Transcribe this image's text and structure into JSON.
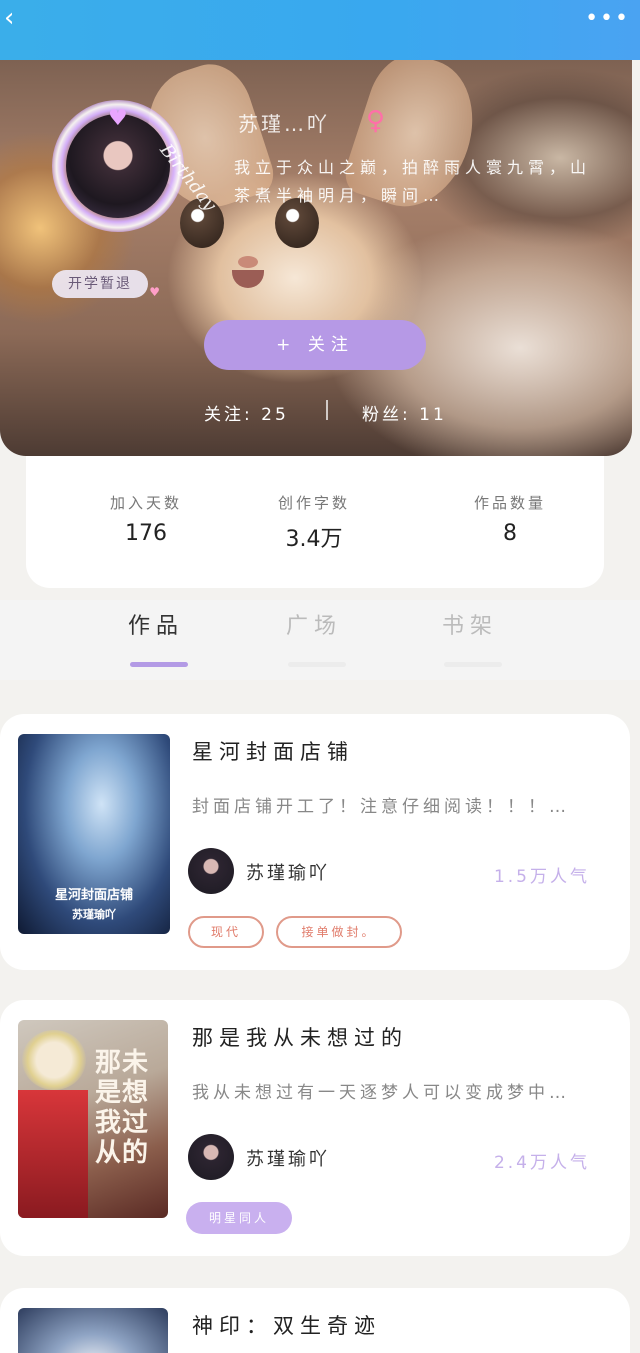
{
  "topbar": {
    "back_icon": "chevron-left-icon",
    "more_icon": "more-dots-icon",
    "back_glyph": "‹",
    "more_glyph": "•••",
    "color": "#3aaeea"
  },
  "profile": {
    "decoration_text": "Birthday",
    "status_tag": "开学暂退",
    "nickname": "苏瑾…吖",
    "gender_symbol": "♀",
    "bio": "我立于众山之巅，拍醉雨人寰九霄，山茶煮半袖明月，瞬间…",
    "follow_button": "+ 关注",
    "following": "关注: 25",
    "fans": "粉丝: 11"
  },
  "stats": [
    {
      "label": "加入天数",
      "value": "176"
    },
    {
      "label": "创作字数",
      "value": "3.4万"
    },
    {
      "label": "作品数量",
      "value": "8"
    }
  ],
  "tabs": [
    {
      "label": "作品",
      "active": true
    },
    {
      "label": "广场",
      "active": false
    },
    {
      "label": "书架",
      "active": false
    }
  ],
  "books": [
    {
      "title": "星河封面店铺",
      "desc": "封面店铺开工了！注意仔细阅读！！！…",
      "author": "苏瑾瑜吖",
      "popularity": "1.5万人气",
      "cover_text_1": "星河封面店铺",
      "cover_text_2": "苏瑾瑜吖",
      "tags": [
        "现代",
        "接单做封。"
      ]
    },
    {
      "title": "那是我从未想过的",
      "desc": "我从未想过有一天逐梦人可以变成梦中…",
      "author": "苏瑾瑜吖",
      "popularity": "2.4万人气",
      "cover_text_1": "那未是想我过从的",
      "tags": [
        "明星同人"
      ]
    },
    {
      "title": "神印：双生奇迹"
    }
  ],
  "colors": {
    "accent": "#b699e6",
    "tag_outline": "#e09a8a",
    "popularity": "#c5b0ea",
    "female": "#ff6fa8"
  }
}
